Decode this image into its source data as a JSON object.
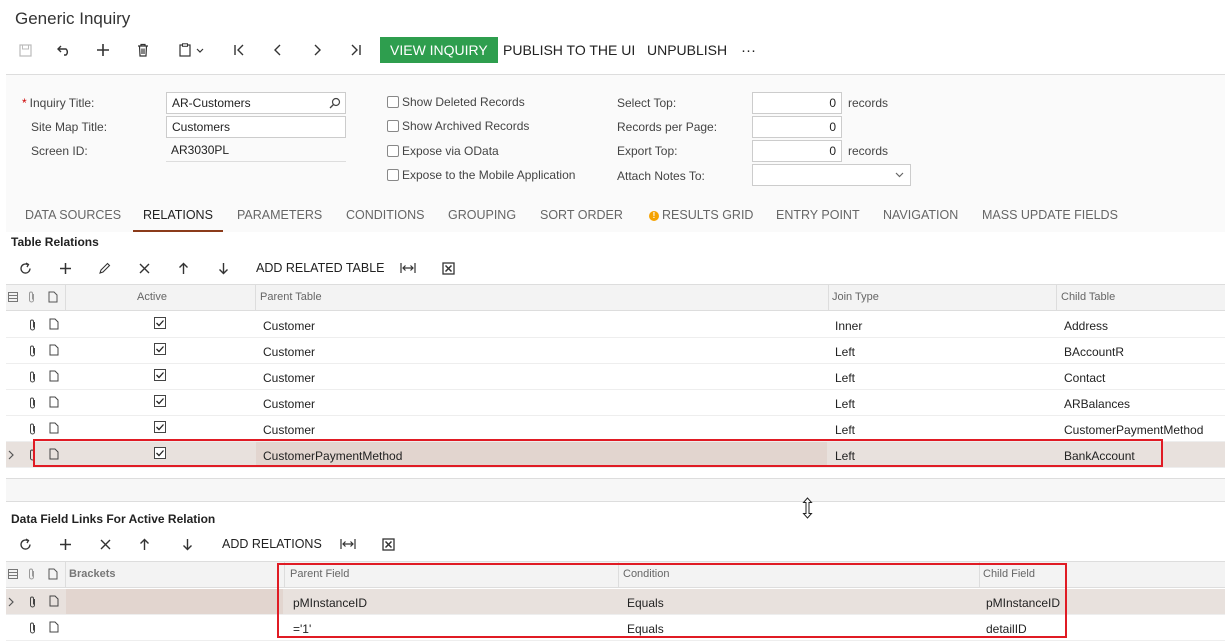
{
  "window": {
    "title": "Generic Inquiry"
  },
  "toolbar": {
    "save_icon": "save-icon",
    "view_inquiry": "VIEW INQUIRY",
    "publish": "PUBLISH TO THE UI",
    "unpublish": "UNPUBLISH",
    "more": "···",
    "brand_color": "#2e9e4e"
  },
  "form": {
    "inquiry_title_label": "Inquiry Title:",
    "inquiry_title_value": "AR-Customers",
    "site_map_title_label": "Site Map Title:",
    "site_map_title_value": "Customers",
    "screen_id_label": "Screen ID:",
    "screen_id_value": "AR3030PL",
    "show_deleted": "Show Deleted Records",
    "show_archived": "Show Archived Records",
    "expose_odata": "Expose via OData",
    "expose_mobile": "Expose to the Mobile Application",
    "select_top_label": "Select Top:",
    "select_top_value": "0",
    "records_per_page_label": "Records per Page:",
    "records_per_page_value": "0",
    "export_top_label": "Export Top:",
    "export_top_value": "0",
    "records_suffix": "records",
    "attach_notes_label": "Attach Notes To:",
    "attach_notes_value": ""
  },
  "tabs": [
    "DATA SOURCES",
    "RELATIONS",
    "PARAMETERS",
    "CONDITIONS",
    "GROUPING",
    "SORT ORDER",
    "RESULTS GRID",
    "ENTRY POINT",
    "NAVIGATION",
    "MASS UPDATE FIELDS"
  ],
  "relations": {
    "title": "Table Relations",
    "add_related_table": "ADD RELATED TABLE",
    "columns": {
      "active": "Active",
      "parent_table": "Parent Table",
      "join_type": "Join Type",
      "child_table": "Child Table"
    },
    "rows": [
      {
        "parent": "Customer",
        "join": "Inner",
        "child": "Address"
      },
      {
        "parent": "Customer",
        "join": "Left",
        "child": "BAccountR"
      },
      {
        "parent": "Customer",
        "join": "Left",
        "child": "Contact"
      },
      {
        "parent": "Customer",
        "join": "Left",
        "child": "ARBalances"
      },
      {
        "parent": "Customer",
        "join": "Left",
        "child": "CustomerPaymentMethod"
      },
      {
        "parent": "CustomerPaymentMethod",
        "join": "Left",
        "child": "BankAccount"
      }
    ]
  },
  "links": {
    "title": "Data Field Links For Active Relation",
    "add_relations": "ADD RELATIONS",
    "columns": {
      "brackets": "Brackets",
      "parent_field": "Parent Field",
      "condition": "Condition",
      "child_field": "Child Field"
    },
    "rows": [
      {
        "parent": "pMInstanceID",
        "condition": "Equals",
        "child": "pMInstanceID"
      },
      {
        "parent": "='1'",
        "condition": "Equals",
        "child": "detailID"
      }
    ]
  },
  "colors": {
    "highlight_box": "#e01b24",
    "active_tab": "#8b3b1a"
  }
}
